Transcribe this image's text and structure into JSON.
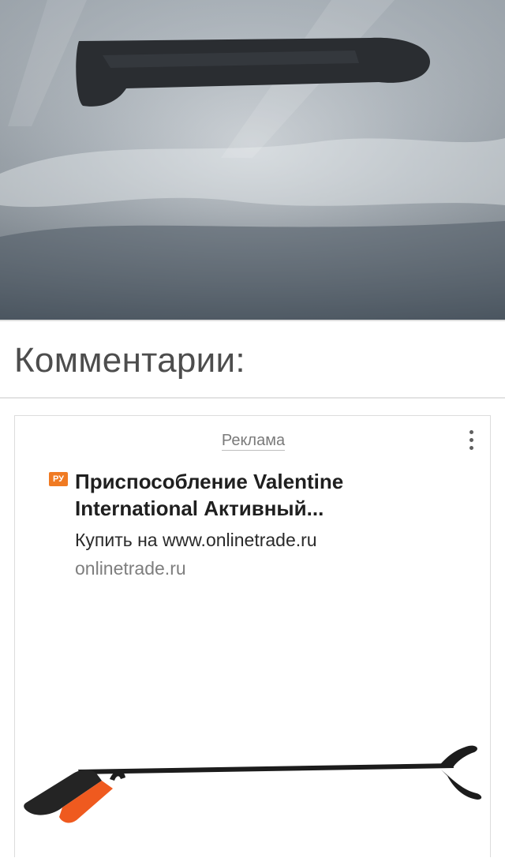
{
  "comments": {
    "heading": "Комментарии:"
  },
  "ad": {
    "label": "Реклама",
    "badge": "РУ",
    "title": "Приспособление Valentine International Активный...",
    "subtitle": "Купить на www.onlinetrade.ru",
    "domain": "onlinetrade.ru",
    "menu_icon": "more-vertical-icon",
    "accent_color": "#f07a22"
  }
}
